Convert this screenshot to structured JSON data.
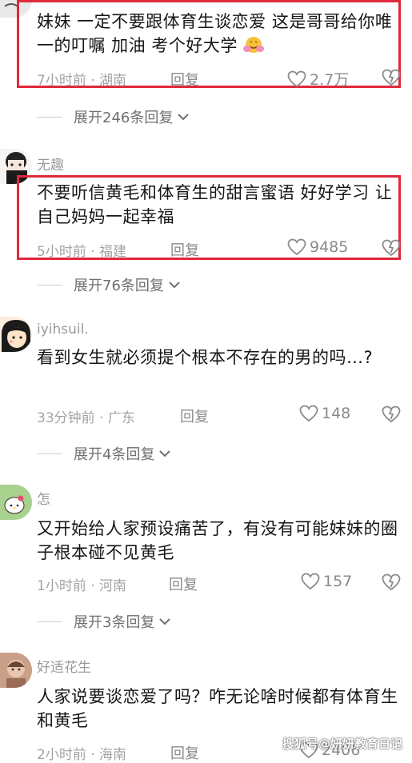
{
  "comments": [
    {
      "username": "",
      "text": "妹妹 一定不要跟体育生谈恋爱 这是哥哥给你唯一的叮嘱 加油 考个好大学",
      "emoji": "hug-emoji",
      "time_location": "7小时前 · 湖南",
      "reply_label": "回复",
      "likes": "2.7万",
      "expand_label": "展开246条回复",
      "highlighted": true
    },
    {
      "username": "无趣",
      "text": "不要听信黄毛和体育生的甜言蜜语 好好学习 让自己妈妈一起幸福",
      "time_location": "5小时前 · 福建",
      "reply_label": "回复",
      "likes": "9485",
      "expand_label": "展开76条回复",
      "highlighted": true
    },
    {
      "username": "iyihsuil.",
      "text": "看到女生就必须提个根本不存在的男的吗…?",
      "time_location": "33分钟前 · 广东",
      "reply_label": "回复",
      "likes": "148",
      "expand_label": "展开4条回复",
      "highlighted": false
    },
    {
      "username": "怎",
      "text": "又开始给人家预设痛苦了，有没有可能妹妹的圈子根本碰不见黄毛",
      "time_location": "1小时前 · 河南",
      "reply_label": "回复",
      "likes": "157",
      "expand_label": "展开3条回复",
      "highlighted": false
    },
    {
      "username": "好适花生",
      "text": "人家说要谈恋爱了吗？咋无论啥时候都有体育生和黄毛",
      "time_location": "2小时前 · 海南",
      "reply_label": "回复",
      "likes": "2406",
      "highlighted": false
    }
  ],
  "watermark": "搜狐号@妍妍教育日记",
  "colors": {
    "highlight_border": "#e0283c",
    "meta_text": "#a3a3a3",
    "body_text": "#161616"
  },
  "icons": [
    "heart-outline-icon",
    "dislike-heart-icon",
    "chevron-down-icon",
    "hug-emoji"
  ]
}
